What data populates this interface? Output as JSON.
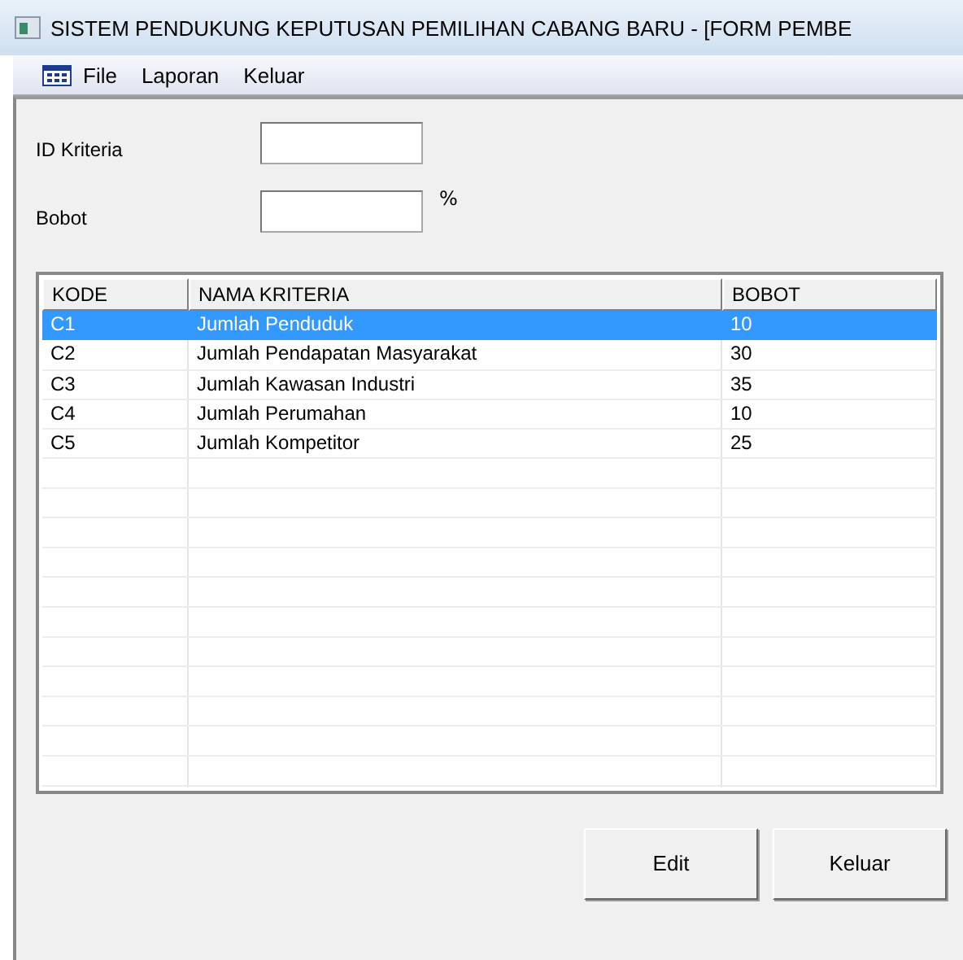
{
  "window": {
    "title": "SISTEM PENDUKUNG KEPUTUSAN PEMILIHAN CABANG BARU - [FORM PEMBE"
  },
  "menu": [
    "File",
    "Laporan",
    "Keluar"
  ],
  "form": {
    "fields": [
      {
        "label": "ID Kriteria"
      },
      {
        "label": "Bobot",
        "unit": "%"
      }
    ]
  },
  "table": {
    "columns": [
      "KODE",
      "NAMA KRITERIA",
      "BOBOT"
    ],
    "rows": [
      {
        "cells": [
          "C1",
          "Jumlah Penduduk",
          "10"
        ],
        "selected": true
      },
      {
        "cells": [
          "C2",
          "Jumlah Pendapatan Masyarakat",
          "30"
        ],
        "selected": false
      },
      {
        "cells": [
          "C3",
          "Jumlah Kawasan Industri",
          "35"
        ],
        "selected": false
      },
      {
        "cells": [
          "C4",
          "Jumlah Perumahan",
          "10"
        ],
        "selected": false
      },
      {
        "cells": [
          "C5",
          "Jumlah Kompetitor",
          "25"
        ],
        "selected": false
      }
    ]
  },
  "buttons": [
    "Edit",
    "Keluar"
  ]
}
